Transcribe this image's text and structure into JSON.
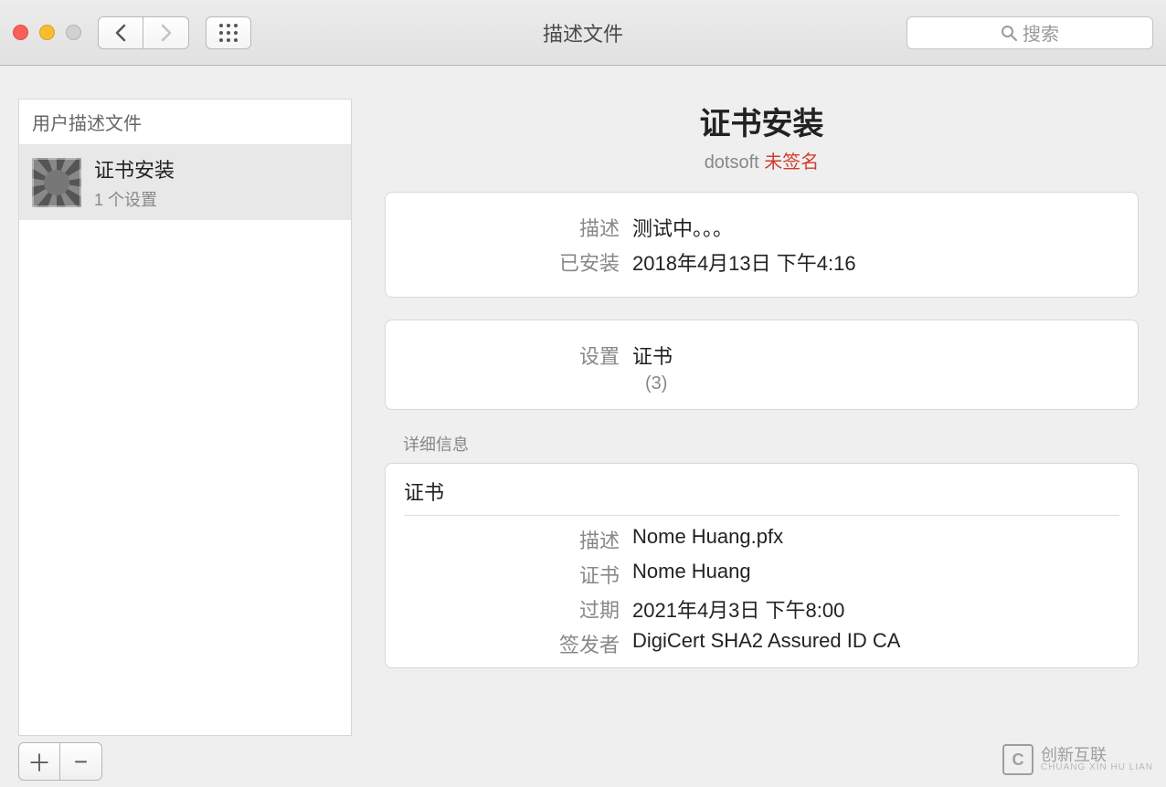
{
  "window": {
    "title": "描述文件",
    "search_placeholder": "搜索"
  },
  "sidebar": {
    "header": "用户描述文件",
    "items": [
      {
        "name": "证书安装",
        "subtitle": "1 个设置"
      }
    ]
  },
  "main": {
    "title": "证书安装",
    "author": "dotsoft",
    "unsigned": "未签名",
    "info_panel": {
      "desc_label": "描述",
      "desc_value": "测试中。。。",
      "installed_label": "已安装",
      "installed_value": "2018年4月13日 下午4:16"
    },
    "settings_panel": {
      "settings_label": "设置",
      "settings_value": "证书",
      "count": "(3)"
    },
    "details_section_label": "详细信息",
    "details": {
      "header": "证书",
      "rows": [
        {
          "label": "描述",
          "value": "Nome Huang.pfx"
        },
        {
          "label": "证书",
          "value": "Nome Huang"
        },
        {
          "label": "过期",
          "value": "2021年4月3日 下午8:00"
        },
        {
          "label": "签发者",
          "value": "DigiCert SHA2 Assured ID CA"
        }
      ]
    }
  },
  "watermark": {
    "logo": "C",
    "cn": "创新互联",
    "en": "CHUANG XIN HU LIAN"
  }
}
